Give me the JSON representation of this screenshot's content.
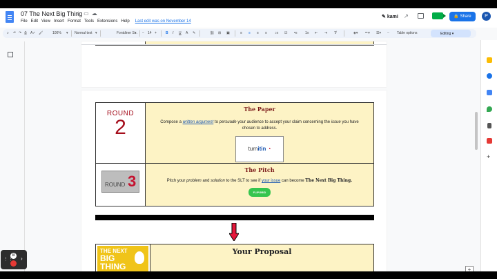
{
  "document": {
    "title": "07 The Next Big Thing",
    "menu": [
      "File",
      "Edit",
      "View",
      "Insert",
      "Format",
      "Tools",
      "Extensions",
      "Help"
    ],
    "last_edit": "Last edit was on November 14"
  },
  "header": {
    "kami": "kami",
    "share_label": "Share",
    "avatar_letter": "P"
  },
  "toolbar": {
    "zoom": "100%",
    "style": "Normal text",
    "font": "Fontdiner S...",
    "font_size": "14",
    "table_options": "Table options",
    "mode": "Editing"
  },
  "round2": {
    "word": "ROUND",
    "number": "2",
    "title": "The Paper",
    "text_a": "Compose a ",
    "text_link1": "written argument",
    "text_b": " to ",
    "text_it1": "persuade",
    "text_c": " your audience to accept your claim concerning the ",
    "text_it2": "issue",
    "text_d": " you have chosen to address.",
    "logo_text_a": "turn",
    "logo_text_b": "itin"
  },
  "round3": {
    "word": "ROUND",
    "number": "3",
    "title": "The Pitch",
    "text_a": "Pitch your ",
    "text_it1": "problem",
    "text_b": " and ",
    "text_it2": "solution",
    "text_c": " to the SLT to see if ",
    "text_link": "your issue",
    "text_d": " can become ",
    "text_bold": "The Next Big Thing.",
    "badge": "FLIPGRID"
  },
  "proposal": {
    "logo_line1": "THE NEXT",
    "logo_line2": "BIG",
    "logo_line3": "THING",
    "title": "Your Proposal"
  },
  "colors": {
    "accent": "#1a73e8",
    "round_red": "#a50e1c",
    "cell_yellow": "#fdf3c5"
  }
}
